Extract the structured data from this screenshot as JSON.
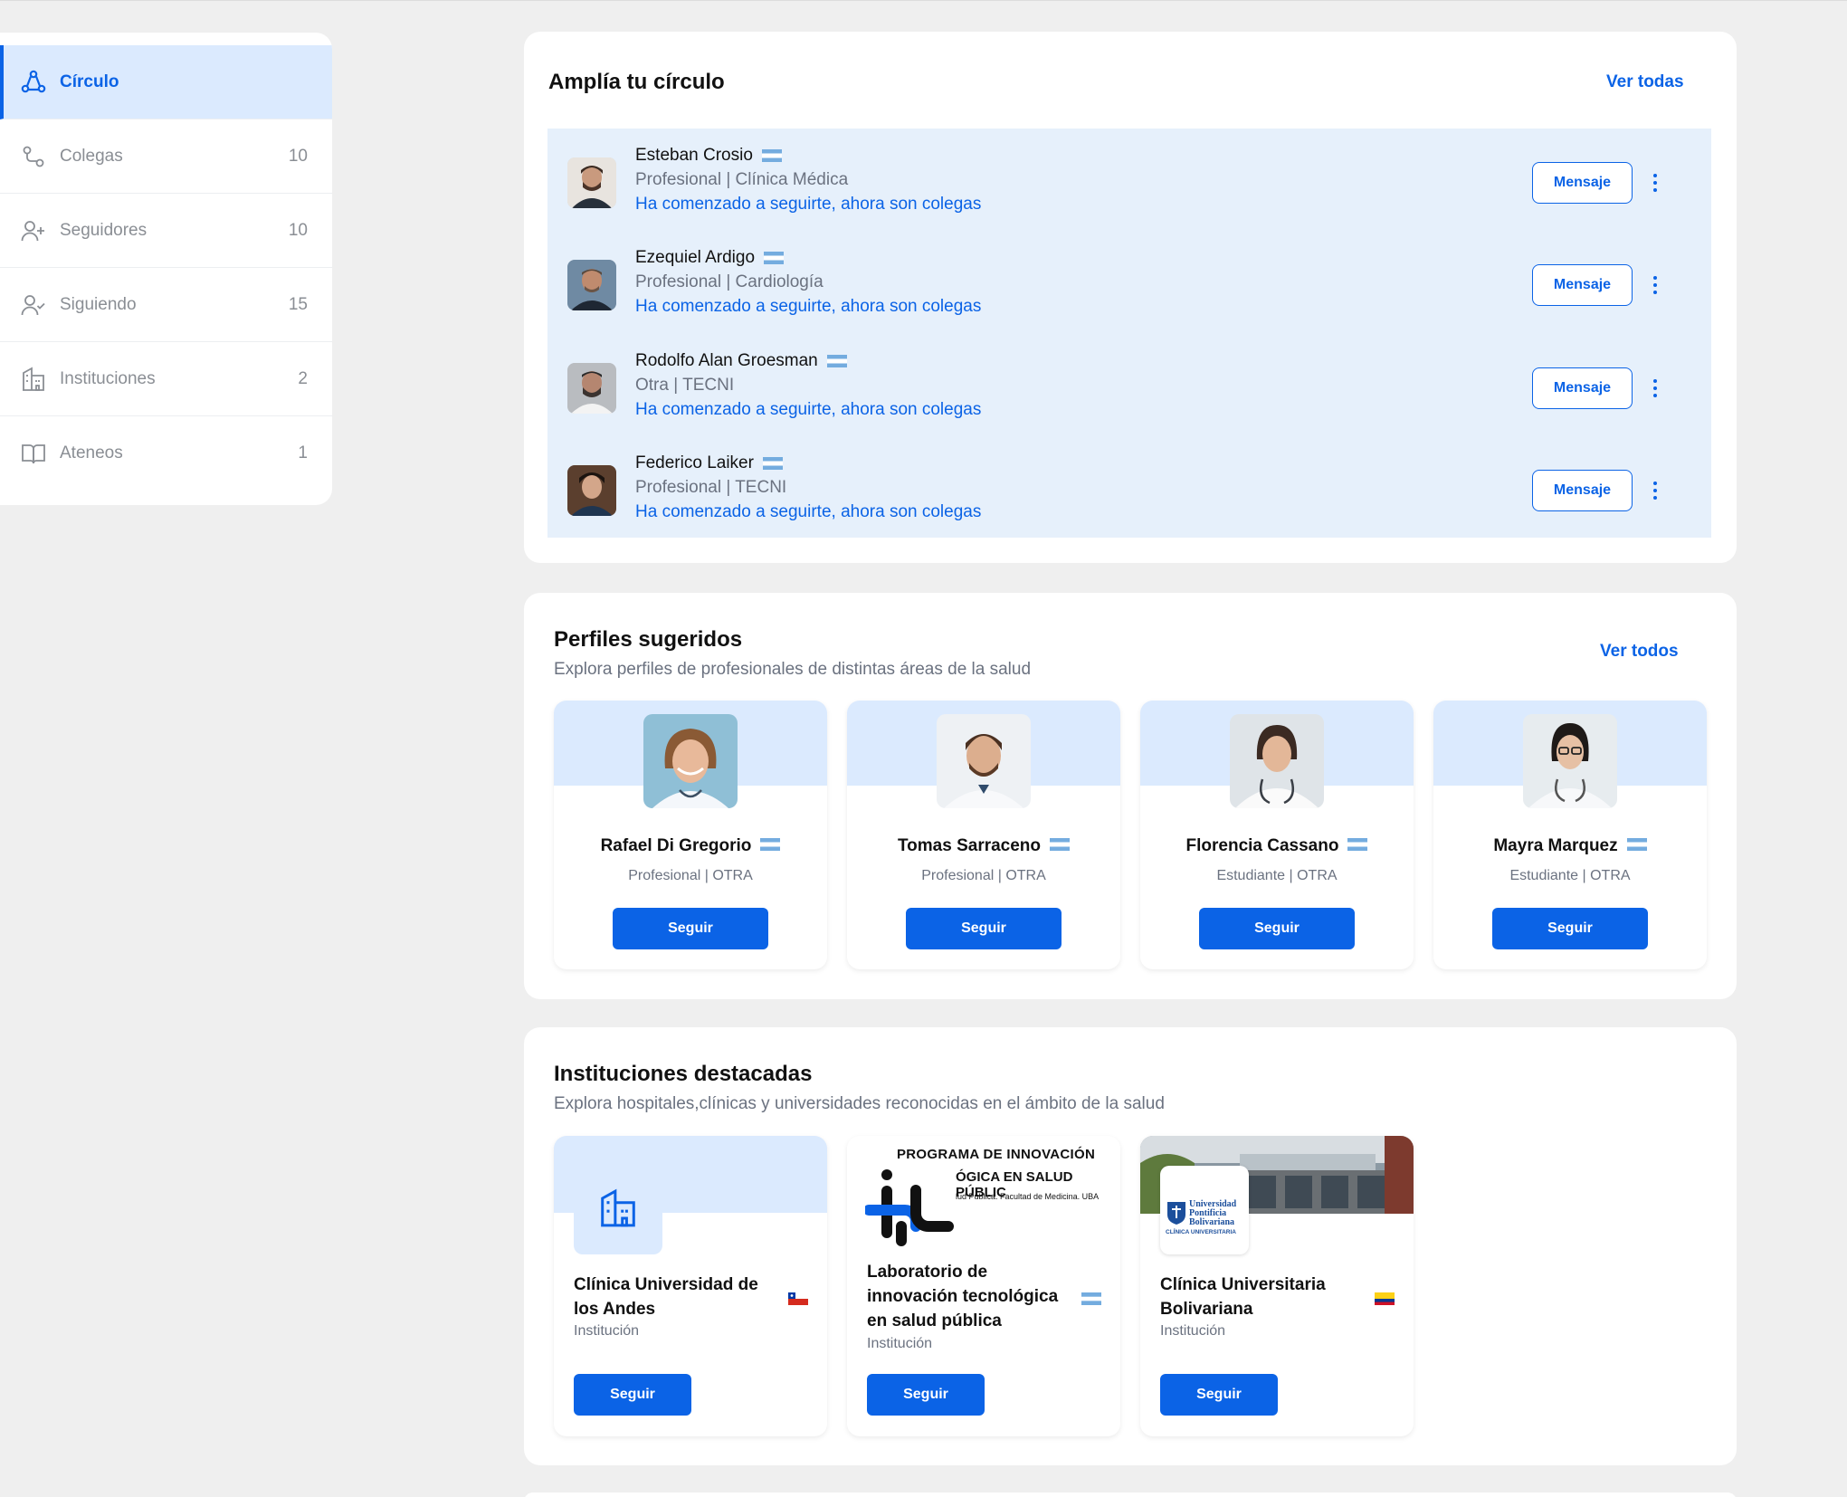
{
  "sidebar": {
    "items": [
      {
        "label": "Círculo",
        "count": ""
      },
      {
        "label": "Colegas",
        "count": "10"
      },
      {
        "label": "Seguidores",
        "count": "10"
      },
      {
        "label": "Siguiendo",
        "count": "15"
      },
      {
        "label": "Instituciones",
        "count": "2"
      },
      {
        "label": "Ateneos",
        "count": "1"
      }
    ]
  },
  "circle": {
    "title": "Amplía tu círculo",
    "see_all": "Ver todas",
    "message_label": "Mensaje",
    "people": [
      {
        "name": "Esteban Crosio",
        "role": "Profesional | Clínica Médica",
        "status": "Ha comenzado a seguirte, ahora son colegas"
      },
      {
        "name": "Ezequiel Ardigo",
        "role": "Profesional | Cardiología",
        "status": "Ha comenzado a seguirte, ahora son colegas"
      },
      {
        "name": "Rodolfo Alan Groesman",
        "role": "Otra | TECNI",
        "status": "Ha comenzado a seguirte, ahora son colegas"
      },
      {
        "name": "Federico Laiker",
        "role": "Profesional | TECNI",
        "status": "Ha comenzado a seguirte, ahora son colegas"
      }
    ]
  },
  "suggested": {
    "title": "Perfiles sugeridos",
    "subtitle": "Explora perfiles de profesionales de distintas áreas de la salud",
    "see_all": "Ver todos",
    "follow_label": "Seguir",
    "profiles": [
      {
        "name": "Rafael Di Gregorio",
        "role": "Profesional | OTRA"
      },
      {
        "name": "Tomas Sarraceno",
        "role": "Profesional | OTRA"
      },
      {
        "name": "Florencia Cassano",
        "role": "Estudiante | OTRA"
      },
      {
        "name": "Mayra Marquez",
        "role": "Estudiante | OTRA"
      }
    ]
  },
  "institutions": {
    "title": "Instituciones destacadas",
    "subtitle": "Explora hospitales,clínicas y universidades reconocidas en el ámbito de la salud",
    "follow_label": "Seguir",
    "items": [
      {
        "name": "Clínica Universidad de los Andes",
        "type": "Institución",
        "flag": "chile"
      },
      {
        "name": "Laboratorio de innovación tecnológica en salud pública",
        "type": "Institución",
        "flag": "argentina"
      },
      {
        "name": "Clínica Universitaria Bolivariana",
        "type": "Institución",
        "flag": "colombia"
      }
    ],
    "logo_texts": {
      "program_line1": "PROGRAMA DE INNOVACIÓN",
      "program_line2": "ÓGICA EN SALUD PÚBLIC",
      "program_line3": "lud Pública. Facultad de Medicina. UBA",
      "upb_line1": "Universidad",
      "upb_line2": "Pontificia",
      "upb_line3": "Bolivariana",
      "upb_line4": "CLÍNICA UNIVERSITARIA"
    }
  },
  "colors": {
    "accent": "#0b63e6",
    "light_accent": "#dbeafe",
    "list_bg": "#e6f0fb"
  }
}
